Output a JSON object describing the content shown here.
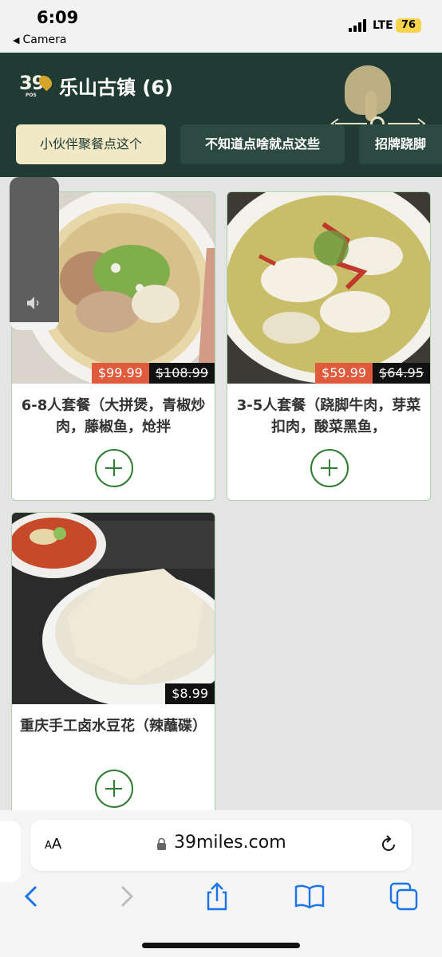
{
  "status_bar": {
    "time": "6:09",
    "back_app": "Camera",
    "network": "LTE",
    "battery": "76"
  },
  "header": {
    "logo_text": "39",
    "logo_sub": "POS",
    "store_title": "乐山古镇 (6)",
    "tabs": [
      {
        "label": "小伙伴聚餐点这个",
        "active": true
      },
      {
        "label": "不知道点啥就点这些",
        "active": false
      },
      {
        "label": "招牌跷脚",
        "active": false
      }
    ]
  },
  "products": [
    {
      "name": "6-8人套餐（大拼煲，青椒炒肉，藤椒鱼，炝拌",
      "price": "$99.99",
      "original_price": "$108.99"
    },
    {
      "name": "3-5人套餐（跷脚牛肉，芽菜扣肉，酸菜黑鱼，",
      "price": "$59.99",
      "original_price": "$64.95"
    },
    {
      "name": "重庆手工卤水豆花（辣蘸碟）",
      "price": "$8.99",
      "original_price": ""
    }
  ],
  "volume_overlay": {
    "level": 0.05,
    "icon": "speaker-icon"
  },
  "browser": {
    "aa_label_small": "A",
    "aa_label_big": "A",
    "url": "39miles.com",
    "toolbar_icons": [
      "back-icon",
      "forward-icon",
      "share-icon",
      "bookmarks-icon",
      "tabs-icon"
    ]
  },
  "colors": {
    "header_bg": "#1f3b33",
    "active_tab_bg": "#f1e8c6",
    "sale_price": "#e05a3c",
    "add_button": "#2e7d32"
  }
}
